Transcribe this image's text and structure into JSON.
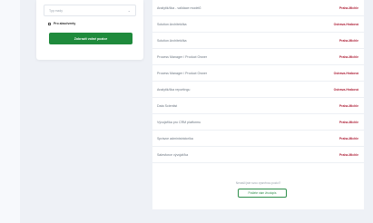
{
  "filters": {
    "select_value": "Typ mzdy",
    "checkbox_label": "Pro absolventy",
    "button_label": "Zobrazit volné pozice"
  },
  "jobs": [
    {
      "title": "Analytik/čka - validace modelů",
      "location": "Praha-Michle"
    },
    {
      "title": "Solution Architekt/ka",
      "location": "Ostrava-Hrabová"
    },
    {
      "title": "Solution Architekt/ka",
      "location": "Praha-Michle"
    },
    {
      "title": "Process Manager / Product Owner",
      "location": "Praha-Michle"
    },
    {
      "title": "Process Manager / Product Owner",
      "location": "Ostrava-Hrabová"
    },
    {
      "title": "Analytik/čka reportingu",
      "location": "Ostrava-Hrabová"
    },
    {
      "title": "Data Scientist",
      "location": "Praha-Michle"
    },
    {
      "title": "Vývojář/ka pro CRM platformu",
      "location": "Praha-Michle"
    },
    {
      "title": "Správce administrátor/ka",
      "location": "Praha-Michle"
    },
    {
      "title": "Salesforce vývojář/ka",
      "location": "Praha-Michle"
    }
  ],
  "footer": {
    "text": "Nenašli jste svou vysněnou pozici?",
    "button_label": "Pošlete nám životopis"
  },
  "colors": {
    "accent_green": "#1f8a3c",
    "location_red": "#b0263d"
  }
}
